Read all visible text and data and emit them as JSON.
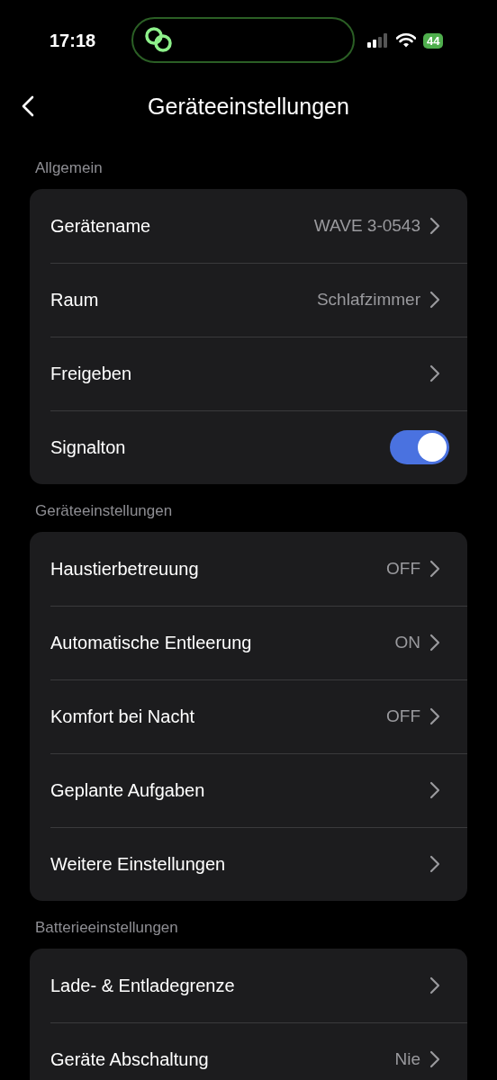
{
  "status_bar": {
    "time": "17:18",
    "battery": "44"
  },
  "header": {
    "title": "Geräteeinstellungen"
  },
  "sections": [
    {
      "title": "Allgemein",
      "rows": [
        {
          "kind": "link",
          "label": "Gerätename",
          "value": "WAVE 3-0543"
        },
        {
          "kind": "link",
          "label": "Raum",
          "value": "Schlafzimmer"
        },
        {
          "kind": "link",
          "label": "Freigeben"
        },
        {
          "kind": "toggle",
          "label": "Signalton",
          "on": true
        }
      ]
    },
    {
      "title": "Geräteeinstellungen",
      "rows": [
        {
          "kind": "link",
          "label": "Haustierbetreuung",
          "value": "OFF"
        },
        {
          "kind": "link",
          "label": "Automatische Entleerung",
          "value": "ON"
        },
        {
          "kind": "link",
          "label": "Komfort bei Nacht",
          "value": "OFF"
        },
        {
          "kind": "link",
          "label": "Geplante Aufgaben"
        },
        {
          "kind": "link",
          "label": "Weitere Einstellungen"
        }
      ]
    },
    {
      "title": "Batterieeinstellungen",
      "rows": [
        {
          "kind": "link",
          "label": "Lade- & Entladegrenze"
        },
        {
          "kind": "link",
          "label": "Geräte Abschaltung",
          "value": "Nie"
        }
      ]
    }
  ]
}
